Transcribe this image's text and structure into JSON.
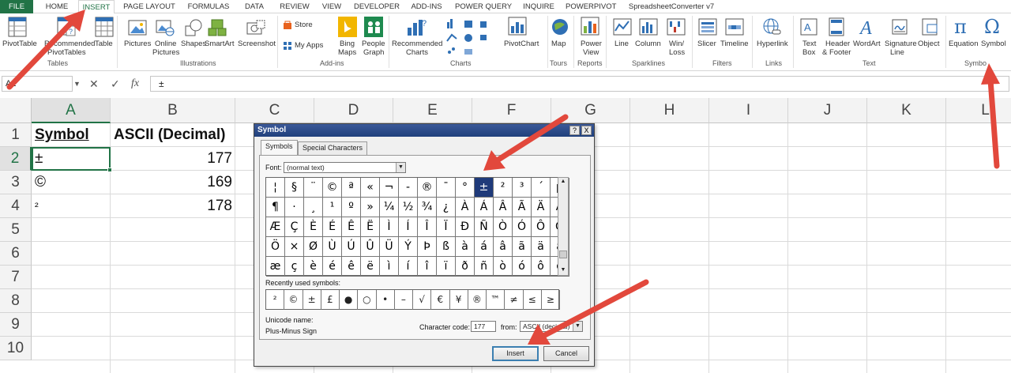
{
  "tabs": [
    "FILE",
    "HOME",
    "INSERT",
    "PAGE LAYOUT",
    "FORMULAS",
    "DATA",
    "REVIEW",
    "VIEW",
    "DEVELOPER",
    "ADD-INS",
    "POWER QUERY",
    "INQUIRE",
    "POWERPIVOT",
    "SpreadsheetConverter v7"
  ],
  "ribbon": {
    "pivottable": "PivotTable",
    "rec_pivot_1": "Recommended",
    "rec_pivot_2": "PivotTables",
    "table": "Table",
    "pictures": "Pictures",
    "online_1": "Online",
    "online_2": "Pictures",
    "shapes": "Shapes",
    "smartart": "SmartArt",
    "screenshot": "Screenshot",
    "store": "Store",
    "myapps": "My Apps",
    "bing_1": "Bing",
    "bing_2": "Maps",
    "people_1": "People",
    "people_2": "Graph",
    "rec_charts_1": "Recommended",
    "rec_charts_2": "Charts",
    "pivotchart": "PivotChart",
    "map": "Map",
    "power_1": "Power",
    "power_2": "View",
    "line": "Line",
    "column": "Column",
    "winloss_1": "Win/",
    "winloss_2": "Loss",
    "slicer": "Slicer",
    "timeline": "Timeline",
    "hyperlink": "Hyperlink",
    "textbox_1": "Text",
    "textbox_2": "Box",
    "hf_1": "Header",
    "hf_2": "& Footer",
    "wordart": "WordArt",
    "sig_1": "Signature",
    "sig_2": "Line",
    "object": "Object",
    "equation": "Equation",
    "symbol": "Symbol",
    "groups": {
      "tables": "Tables",
      "illustrations": "Illustrations",
      "addins": "Add-ins",
      "charts": "Charts",
      "tours": "Tours",
      "reports": "Reports",
      "sparklines": "Sparklines",
      "filters": "Filters",
      "links": "Links",
      "text": "Text",
      "symbols": "Symbo"
    }
  },
  "formula_bar": {
    "name_box": "A2",
    "fx": "fx",
    "value": "±"
  },
  "columns": [
    "A",
    "B",
    "C",
    "D",
    "E",
    "F",
    "G",
    "H",
    "I",
    "J",
    "K",
    "L"
  ],
  "rows": [
    "1",
    "2",
    "3",
    "4",
    "5",
    "6",
    "7",
    "8",
    "9",
    "10"
  ],
  "cells": {
    "a1": "Symbol",
    "b1": "ASCII (Decimal)",
    "a2": "±",
    "b2": "177",
    "a3": "©",
    "b3": "169",
    "a4": "²",
    "b4": "178"
  },
  "dialog": {
    "title": "Symbol",
    "help_btn": "?",
    "close_btn": "X",
    "tab_symbols": "Symbols",
    "tab_special": "Special Characters",
    "font_label": "Font:",
    "font_value": "(normal text)",
    "grid_rows": [
      [
        "¦",
        "§",
        "¨",
        "©",
        "ª",
        "«",
        "¬",
        "-",
        "®",
        "¯",
        "°",
        "±",
        "²",
        "³",
        "´",
        "µ"
      ],
      [
        "¶",
        "·",
        "¸",
        "¹",
        "º",
        "»",
        "¼",
        "½",
        "¾",
        "¿",
        "À",
        "Á",
        "Â",
        "Ã",
        "Ä",
        "Å"
      ],
      [
        "Æ",
        "Ç",
        "È",
        "É",
        "Ê",
        "Ë",
        "Ì",
        "Í",
        "Î",
        "Ï",
        "Ð",
        "Ñ",
        "Ò",
        "Ó",
        "Ô",
        "Õ"
      ],
      [
        "Ö",
        "×",
        "Ø",
        "Ù",
        "Ú",
        "Û",
        "Ü",
        "Ý",
        "Þ",
        "ß",
        "à",
        "á",
        "â",
        "ã",
        "ä",
        "å"
      ],
      [
        "æ",
        "ç",
        "è",
        "é",
        "ê",
        "ë",
        "ì",
        "í",
        "î",
        "ï",
        "ð",
        "ñ",
        "ò",
        "ó",
        "ô",
        "õ"
      ]
    ],
    "selected_symbol": "±",
    "recent_label": "Recently used symbols:",
    "recent": [
      "²",
      "©",
      "±",
      "£",
      "●",
      "○",
      "•",
      "–",
      "√",
      "€",
      "¥",
      "®",
      "™",
      "≠",
      "≤",
      "≥"
    ],
    "unicode_label": "Unicode name:",
    "unicode_name": "Plus-Minus Sign",
    "charcode_label": "Character code:",
    "charcode_value": "177",
    "from_label": "from:",
    "from_value": "ASCII (decimal)",
    "insert_btn": "Insert",
    "cancel_btn": "Cancel"
  },
  "colors": {
    "accent_green": "#217346",
    "arrow_red": "#e2483c",
    "dialog_title": "#20407c",
    "selected_symbol_bg": "#1f3a7a"
  }
}
